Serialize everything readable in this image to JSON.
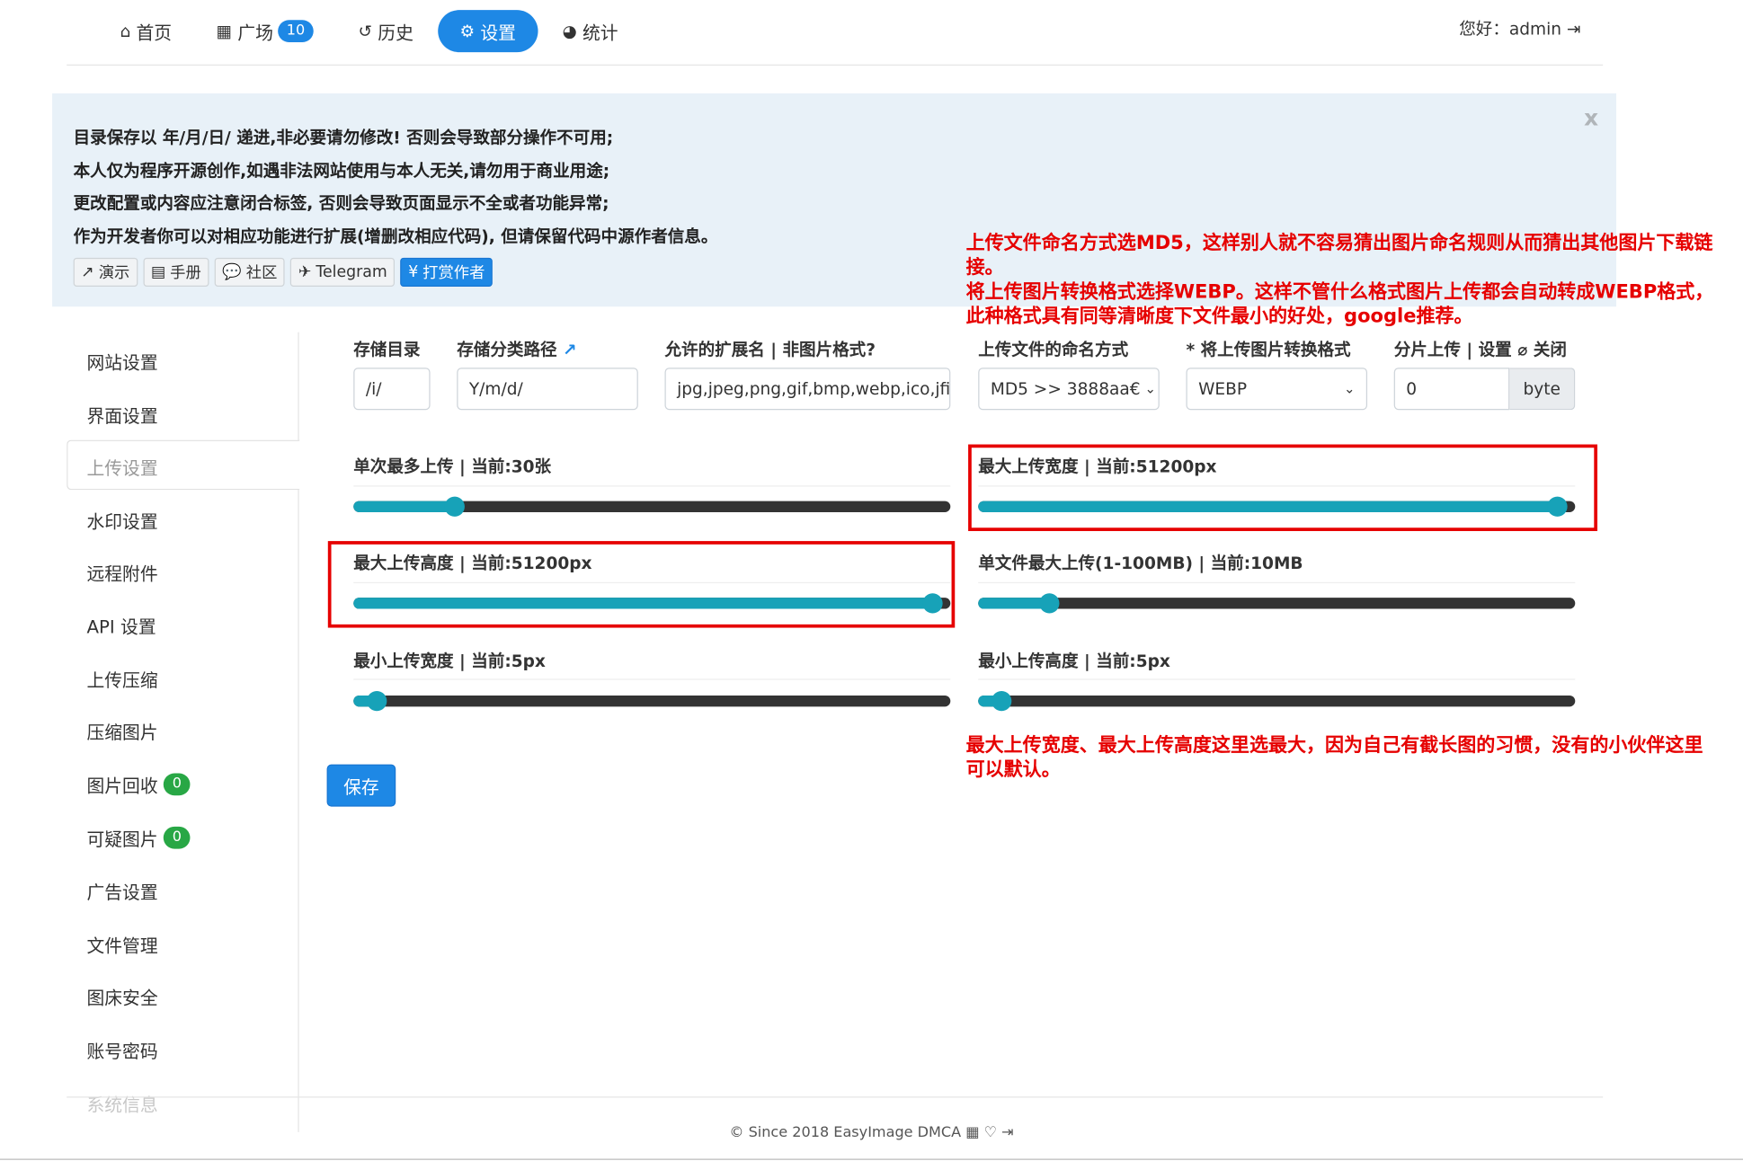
{
  "nav": {
    "items": [
      {
        "icon": "home-icon",
        "glyph": "⌂",
        "label": "首页"
      },
      {
        "icon": "grid-icon",
        "glyph": "▦",
        "label": "广场",
        "badge": "10"
      },
      {
        "icon": "history-icon",
        "glyph": "↺",
        "label": "历史"
      },
      {
        "icon": "gears-icon",
        "glyph": "⚙",
        "label": "设置",
        "active": true
      },
      {
        "icon": "pie-chart-icon",
        "glyph": "◕",
        "label": "统计"
      }
    ],
    "user": "您好：admin"
  },
  "alert": {
    "lines": [
      "目录保存以 年/月/日/ 递进,非必要请勿修改! 否则会导致部分操作不可用;",
      "本人仅为程序开源创作,如遇非法网站使用与本人无关,请勿用于商业用途;",
      "更改配置或内容应注意闭合标签, 否则会导致页面显示不全或者功能异常;",
      "作为开发者你可以对相应功能进行扩展(增删改相应代码), 但请保留代码中源作者信息。"
    ],
    "close": "x",
    "buttons": [
      {
        "icon": "external-link-icon",
        "glyph": "↗",
        "label": "演示"
      },
      {
        "icon": "book-icon",
        "glyph": "▤",
        "label": "手册"
      },
      {
        "icon": "comments-icon",
        "glyph": "💬",
        "label": "社区"
      },
      {
        "icon": "paper-plane-icon",
        "glyph": "✈",
        "label": "Telegram"
      },
      {
        "icon": "yen-icon",
        "glyph": "¥",
        "label": "打赏作者"
      }
    ]
  },
  "sidebar": {
    "items": [
      "网站设置",
      "界面设置",
      "上传设置",
      "水印设置",
      "远程附件",
      "API 设置",
      "上传压缩",
      "压缩图片",
      "图片回收",
      "可疑图片",
      "广告设置",
      "文件管理",
      "图床安全",
      "账号密码",
      "系统信息"
    ],
    "badges": {
      "recycle": "0",
      "suspicious": "0"
    }
  },
  "form": {
    "storage_dir": {
      "label": "存储目录",
      "value": "/i/"
    },
    "storage_path": {
      "label": "存储分类路径",
      "value": "Y/m/d/"
    },
    "extensions": {
      "label": "允许的扩展名 | 非图片格式?",
      "value": "jpg,jpeg,png,gif,bmp,webp,ico,jfif,t"
    },
    "naming": {
      "label": "上传文件的命名方式",
      "value": "MD5 >> 3888aa€"
    },
    "convert": {
      "label": "* 将上传图片转换格式",
      "value": "WEBP"
    },
    "chunk": {
      "label": "分片上传 | 设置 ⌀ 关闭",
      "value": "0",
      "unit": "byte"
    },
    "sliders": {
      "max_count": {
        "label": "单次最多上传 | 当前:30张",
        "level": 0.17
      },
      "max_width": {
        "label": "最大上传宽度 | 当前:51200px",
        "level": 0.97
      },
      "max_height": {
        "label": "最大上传高度 | 当前:51200px",
        "level": 0.97
      },
      "max_size": {
        "label": "单文件最大上传(1-100MB) | 当前:10MB",
        "level": 0.12
      },
      "min_width": {
        "label": "最小上传宽度 | 当前:5px",
        "level": 0.04
      },
      "min_height": {
        "label": "最小上传高度 | 当前:5px",
        "level": 0.04
      }
    },
    "save": "保存"
  },
  "annotations": {
    "note1": [
      "上传文件命名方式选MD5，这样别人就不容易猜出图片命名规则从而猜出其他图片下载链",
      "接。",
      "将上传图片转换格式选择WEBP。这样不管什么格式图片上传都会自动转成WEBP格式，",
      "此种格式具有同等清晰度下文件最小的好处，google推荐。"
    ],
    "note2": [
      "最大上传宽度、最大上传高度这里选最大，因为自己有截长图的习惯，没有的小伙伴这里",
      "可以默认。"
    ]
  },
  "footer": {
    "text": "© Since 2018 EasyImage DMCA",
    "icons": [
      "qrcode-icon",
      "lightbulb-icon",
      "sign-out-icon"
    ]
  },
  "colors": {
    "primary": "#1e88e5",
    "slider": "#17a2b8",
    "annotation": "#e60000",
    "badge_green": "#28a745"
  }
}
